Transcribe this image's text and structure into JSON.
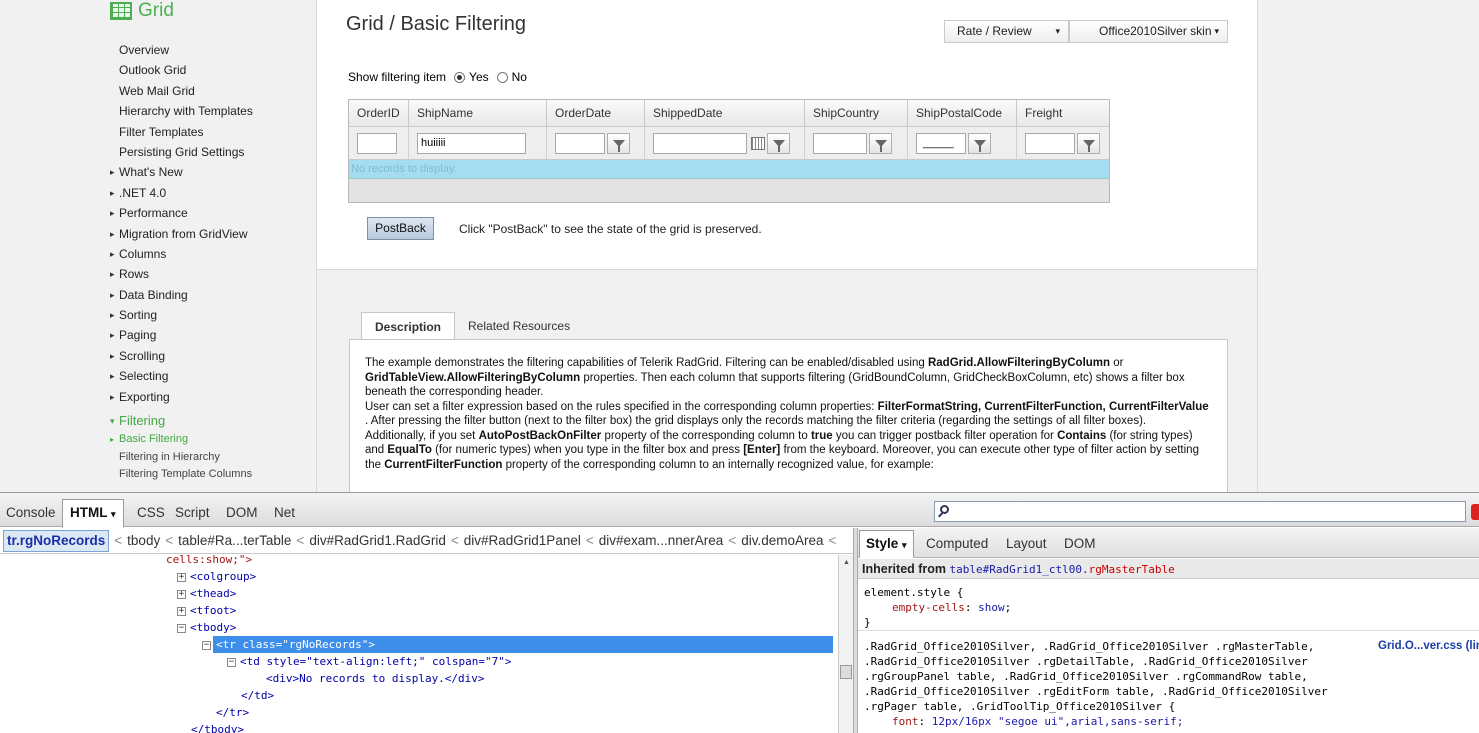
{
  "sidebar": {
    "logo_text": "Grid",
    "items": [
      {
        "label": "Overview",
        "expandable": false
      },
      {
        "label": "Outlook Grid",
        "expandable": false
      },
      {
        "label": "Web Mail Grid",
        "expandable": false
      },
      {
        "label": "Hierarchy with Templates",
        "expandable": false
      },
      {
        "label": "Filter Templates",
        "expandable": false
      },
      {
        "label": "Persisting Grid Settings",
        "expandable": false
      },
      {
        "label": "What's New",
        "expandable": true
      },
      {
        "label": ".NET 4.0",
        "expandable": true
      },
      {
        "label": "Performance",
        "expandable": true
      },
      {
        "label": "Migration from GridView",
        "expandable": true
      },
      {
        "label": "Columns",
        "expandable": true
      },
      {
        "label": "Rows",
        "expandable": true
      },
      {
        "label": "Data Binding",
        "expandable": true
      },
      {
        "label": "Sorting",
        "expandable": true
      },
      {
        "label": "Paging",
        "expandable": true
      },
      {
        "label": "Scrolling",
        "expandable": true
      },
      {
        "label": "Selecting",
        "expandable": true
      },
      {
        "label": "Exporting",
        "expandable": true
      }
    ],
    "open_section": "Filtering",
    "sub_items": [
      "Basic Filtering",
      "Filtering in Hierarchy",
      "Filtering Template Columns"
    ]
  },
  "demo": {
    "title": "Grid / Basic Filtering",
    "rate_review": "Rate / Review",
    "skin": "Office2010Silver skin",
    "show_filtering_label": "Show filtering item",
    "yes": "Yes",
    "no": "No",
    "columns": [
      "OrderID",
      "ShipName",
      "OrderDate",
      "ShippedDate",
      "ShipCountry",
      "ShipPostalCode",
      "Freight"
    ],
    "shipname_filter_value": "huiiiii",
    "postal_mask": "_____",
    "no_records": "No records to display.",
    "postback": "PostBack",
    "postback_note": "Click \"PostBack\" to see the state of the grid is preserved."
  },
  "tabs": [
    "Description",
    "Related Resources"
  ],
  "description": {
    "p1_a": "The example demonstrates the filtering capabilities of Telerik RadGrid. Filtering can be enabled/disabled using ",
    "p1_b": "RadGrid.AllowFilteringByColumn",
    "p1_c": " or ",
    "p1_d": "GridTableView.AllowFilteringByColumn",
    "p1_e": " properties. Then each column that supports filtering (GridBoundColumn, GridCheckBoxColumn, etc) shows a filter box beneath the corresponding header.",
    "p2_a": "User can set a filter expression based on the rules specified in the corresponding column properties: ",
    "p2_b": "FilterFormatString, CurrentFilterFunction, CurrentFilterValue",
    "p2_c": " . After pressing the filter button (next to the filter box) the grid displays only the records matching the filter criteria (regarding the settings of all filter boxes).",
    "p3_a": "Additionally, if you set ",
    "p3_b": "AutoPostBackOnFilter",
    "p3_c": " property of the corresponding column to ",
    "p3_d": "true",
    "p3_e": " you can trigger postback filter operation for ",
    "p3_f": "Contains",
    "p3_g": " (for string types) and ",
    "p3_h": "EqualTo",
    "p3_i": " (for numeric types) when you type in the filter box and press ",
    "p3_j": "[Enter]",
    "p3_k": " from the keyboard. Moreover, you can execute other type of filter action by setting the ",
    "p3_l": "CurrentFilterFunction",
    "p3_m": " property of the corresponding column to an internally recognized value, for example:"
  },
  "firebug": {
    "tabs": [
      "Console",
      "HTML",
      "CSS",
      "Script",
      "DOM",
      "Net"
    ],
    "selected_tab": "HTML",
    "breadcrumb": [
      "tr.rgNoRecords",
      "tbody",
      "table#Ra...terTable",
      "div#RadGrid1.RadGrid",
      "div#RadGrid1Panel",
      "div#exam...nnerArea",
      "div.demoArea"
    ],
    "code": {
      "l0": "cells:show;\">",
      "l1": "<colgroup>",
      "l2": "<thead>",
      "l3": "<tfoot>",
      "l4": "<tbody>",
      "l5": "<tr class=\"rgNoRecords\">",
      "l6a": "<td style=\"text-align:left;\" colspan=\"7\">",
      "l7": "<div>No records to display.</div>",
      "l8": "</td>",
      "l9": "</tr>",
      "l10": "</tbody>"
    },
    "side_tabs": [
      "Style",
      "Computed",
      "Layout",
      "DOM"
    ],
    "inherited_label": "Inherited from",
    "inherited_sel": "table#RadGrid1_ctl00.",
    "inherited_cls": "rgMasterTable",
    "css": {
      "r1": "element.style {",
      "r1p": "empty-cells",
      "r1v": "show",
      "r1c": "}",
      "s1": ".RadGrid_Office2010Silver, .RadGrid_Office2010Silver .rgMasterTable,",
      "s2": ".RadGrid_Office2010Silver .rgDetailTable, .RadGrid_Office2010Silver",
      "s3": ".rgGroupPanel table, .RadGrid_Office2010Silver .rgCommandRow table,",
      "s4": ".RadGrid_Office2010Silver .rgEditForm table, .RadGrid_Office2010Silver",
      "s5": ".rgPager table, .GridToolTip_Office2010Silver {",
      "fp": "font",
      "fv": "12px/16px \"segoe ui\",arial,sans-serif;",
      "link": "Grid.O...ver.css (lin"
    }
  }
}
